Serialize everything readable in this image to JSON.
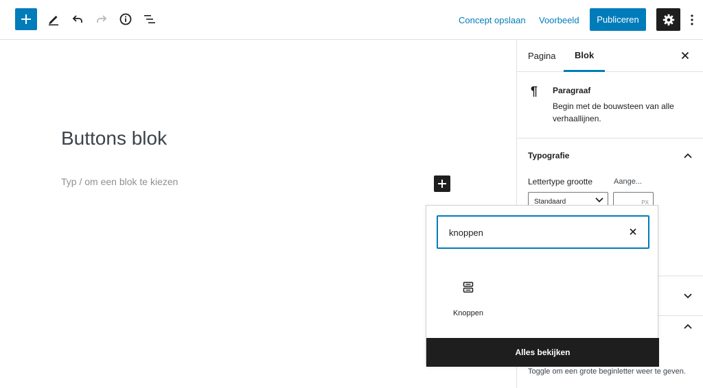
{
  "toolbar": {
    "save_draft": "Concept opslaan",
    "preview": "Voorbeeld",
    "publish": "Publiceren"
  },
  "editor": {
    "title": "Buttons blok",
    "placeholder": "Typ / om een blok te kiezen"
  },
  "sidebar": {
    "tabs": [
      "Pagina",
      "Blok"
    ],
    "block": {
      "name": "Paragraaf",
      "description": "Begin met de bouwsteen van alle verhaallijnen."
    },
    "typography": {
      "title": "Typografie",
      "font_size_label": "Lettertype grootte",
      "custom_label": "Aange...",
      "select_value": "Standaard",
      "unit": "PX"
    },
    "dropcap_help": "Toggle om een grote beginletter weer te geven."
  },
  "inserter": {
    "search_value": "knoppen",
    "results": [
      {
        "label": "Knoppen",
        "icon": "buttons-icon"
      }
    ],
    "browse_all": "Alles bekijken"
  },
  "colors": {
    "accent": "#007cba",
    "dark": "#1e1e1e"
  }
}
